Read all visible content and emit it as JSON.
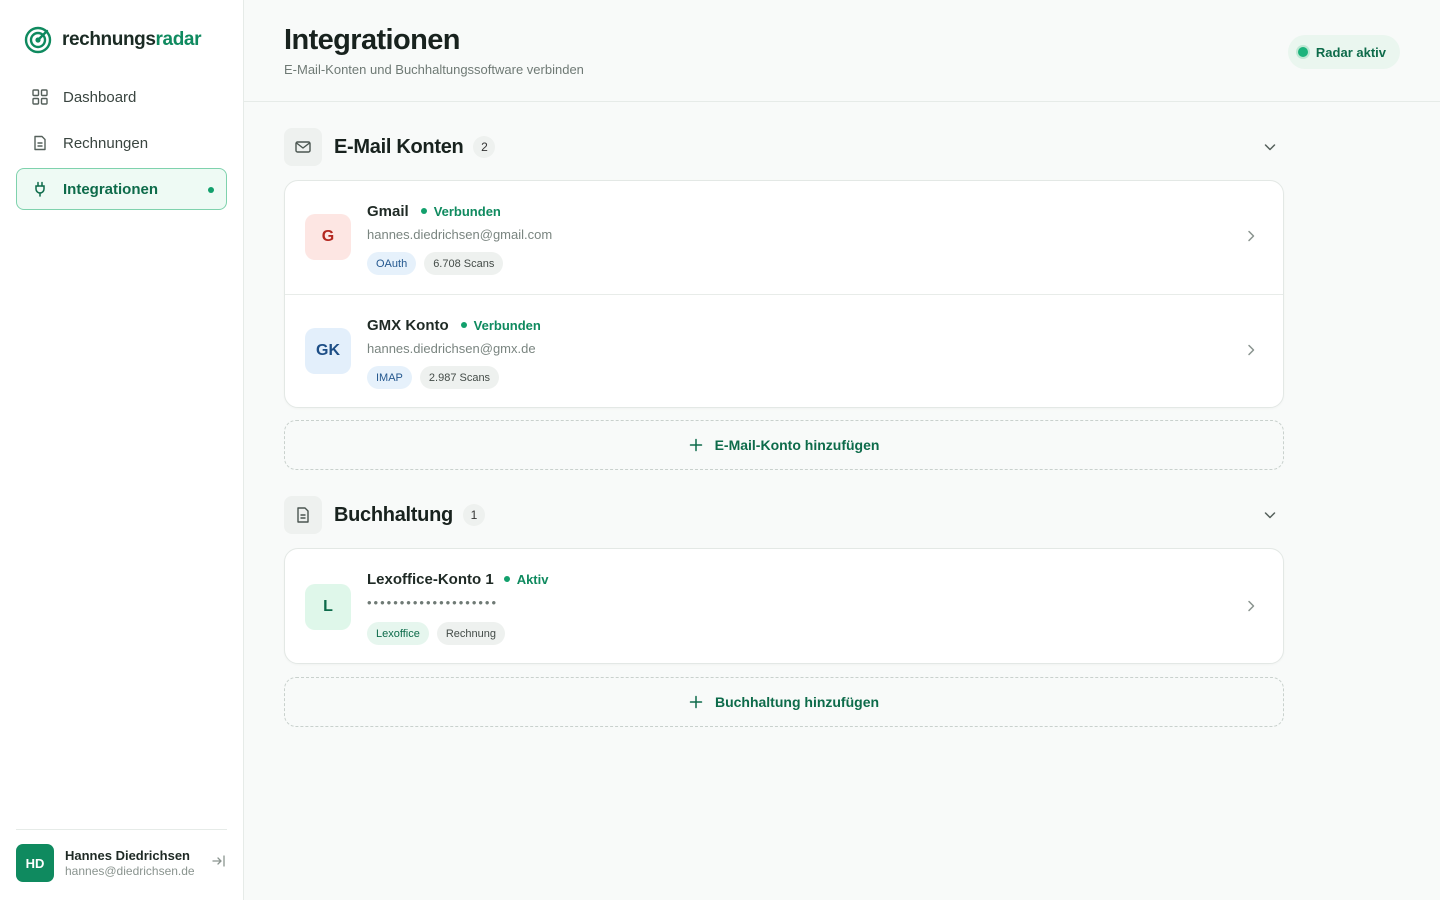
{
  "brand": {
    "name_part1": "rechnungs",
    "name_part2": "radar"
  },
  "nav": {
    "items": [
      {
        "label": "Dashboard",
        "icon": "grid-icon"
      },
      {
        "label": "Rechnungen",
        "icon": "document-icon"
      },
      {
        "label": "Integrationen",
        "icon": "plug-icon",
        "active": true
      }
    ]
  },
  "user": {
    "initials": "HD",
    "name": "Hannes Diedrichsen",
    "email": "hannes@diedrichsen.de"
  },
  "header": {
    "title": "Integrationen",
    "subtitle": "E-Mail-Konten und Buchhaltungssoftware verbinden",
    "badge": "Radar aktiv"
  },
  "email_section": {
    "title": "E-Mail Konten",
    "count": "2",
    "accounts": [
      {
        "initials": "G",
        "name": "Gmail",
        "status": "Verbunden",
        "email": "hannes.diedrichsen@gmail.com",
        "tag1": "OAuth",
        "tag2": "6.708 Scans"
      },
      {
        "initials": "GK",
        "name": "GMX Konto",
        "status": "Verbunden",
        "email": "hannes.diedrichsen@gmx.de",
        "tag1": "IMAP",
        "tag2": "2.987 Scans"
      }
    ],
    "add_label": "E-Mail-Konto hinzufügen"
  },
  "accounting_section": {
    "title": "Buchhaltung",
    "count": "1",
    "accounts": [
      {
        "initials": "L",
        "name": "Lexoffice-Konto 1",
        "status": "Aktiv",
        "secret": "••••••••••••••••••••",
        "tag1": "Lexoffice",
        "tag2": "Rechnung"
      }
    ],
    "add_label": "Buchhaltung hinzufügen"
  },
  "colors": {
    "accent": "#0f8a5f",
    "accent_light": "#eefaf4",
    "gmail_avatar_bg": "#fde6e3",
    "gmail_avatar_fg": "#b3261e",
    "gmx_avatar_bg": "#e3effb",
    "gmx_avatar_fg": "#1d4e86",
    "lexoffice_avatar_bg": "#dff7ea",
    "lexoffice_avatar_fg": "#0d6b4a"
  }
}
